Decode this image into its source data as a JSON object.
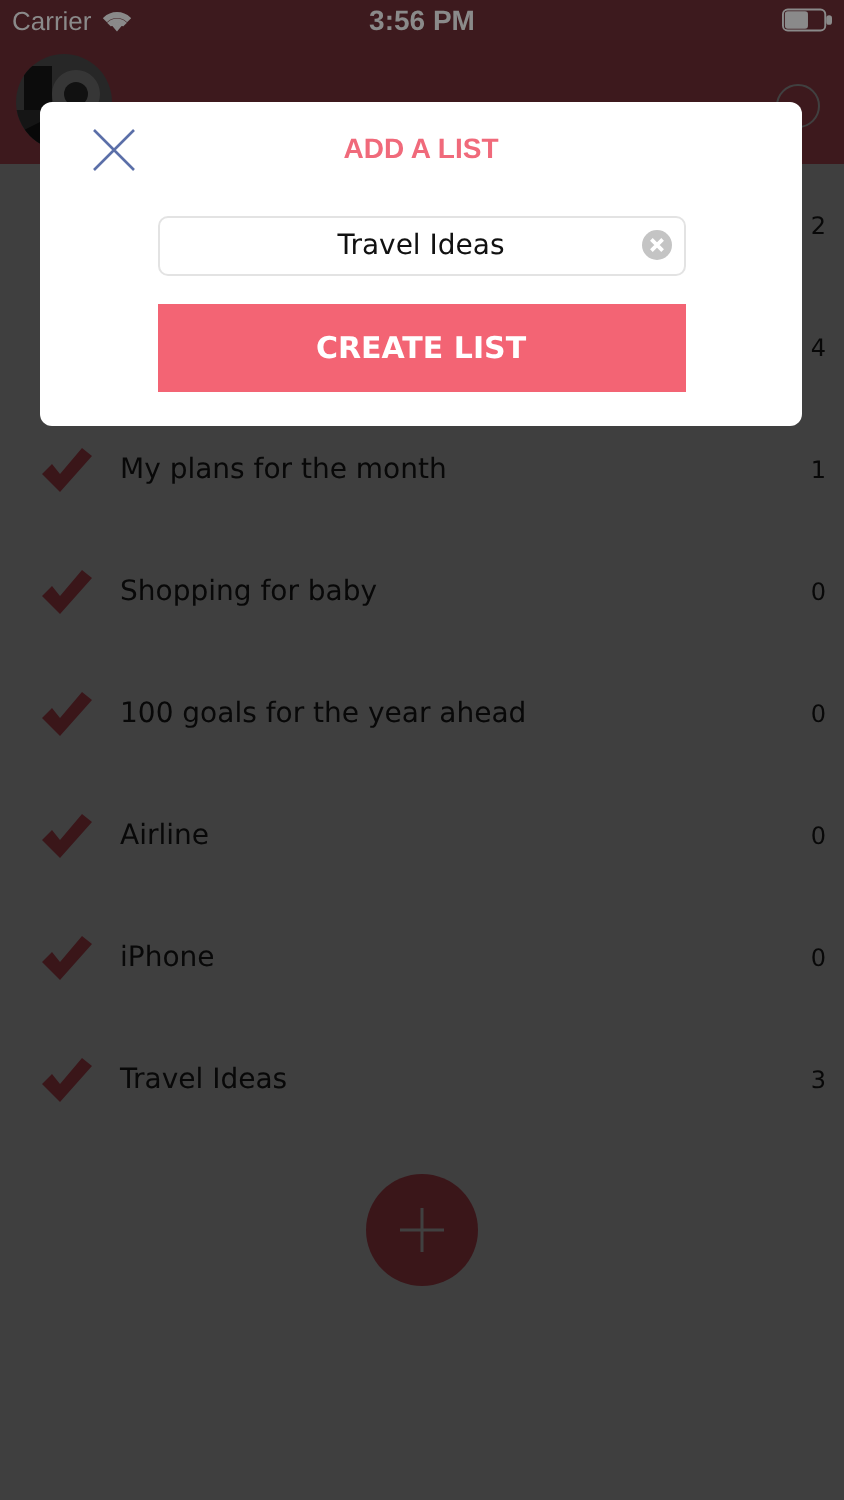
{
  "status_bar": {
    "carrier": "Carrier",
    "time": "3:56 PM"
  },
  "lists": [
    {
      "count": "2"
    },
    {
      "count": "4"
    },
    {
      "name": "My plans for the month",
      "count": "1"
    },
    {
      "name": "Shopping for baby",
      "count": "0"
    },
    {
      "name": "100 goals for the year ahead",
      "count": "0"
    },
    {
      "name": "Airline",
      "count": "0"
    },
    {
      "name": "iPhone",
      "count": "0"
    },
    {
      "name": "Travel Ideas",
      "count": "3"
    }
  ],
  "dialog": {
    "title": "ADD A LIST",
    "field": {
      "value": "Travel Ideas"
    },
    "button": "CREATE LIST"
  }
}
